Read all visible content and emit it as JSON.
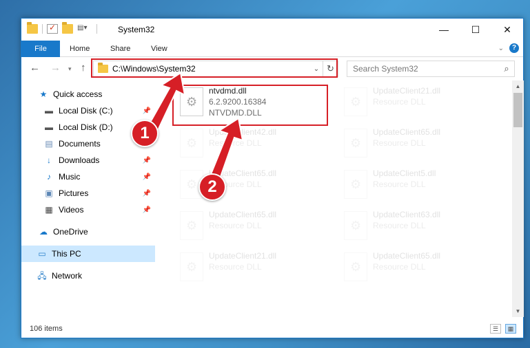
{
  "window": {
    "title": "System32",
    "controls": {
      "minimize": "—",
      "maximize": "☐",
      "close": "✕"
    }
  },
  "ribbon": {
    "tabs": [
      {
        "label": "File"
      },
      {
        "label": "Home"
      },
      {
        "label": "Share"
      },
      {
        "label": "View"
      }
    ],
    "help": "?"
  },
  "address": {
    "path": "C:\\Windows\\System32"
  },
  "search": {
    "placeholder": "Search System32"
  },
  "nav": {
    "items": [
      {
        "label": "Quick access",
        "icon": "star-icon"
      },
      {
        "label": "Local Disk (C:)",
        "icon": "drive-icon",
        "pinned": true
      },
      {
        "label": "Local Disk (D:)",
        "icon": "drive-icon"
      },
      {
        "label": "Documents",
        "icon": "documents-icon",
        "pinned": true
      },
      {
        "label": "Downloads",
        "icon": "download-icon",
        "pinned": true
      },
      {
        "label": "Music",
        "icon": "music-icon",
        "pinned": true
      },
      {
        "label": "Pictures",
        "icon": "pictures-icon",
        "pinned": true
      },
      {
        "label": "Videos",
        "icon": "videos-icon",
        "pinned": true
      },
      {
        "label": "OneDrive",
        "icon": "cloud-icon"
      },
      {
        "label": "This PC",
        "icon": "computer-icon",
        "selected": true
      },
      {
        "label": "Network",
        "icon": "network-icon"
      }
    ]
  },
  "files": [
    {
      "name": "ntvdmd.dll",
      "line2": "6.2.9200.16384",
      "line3": "NTVDMD.DLL",
      "faded": false
    },
    {
      "name": "UpdateClient21.dll",
      "line2": "Resource DLL",
      "faded": true
    },
    {
      "name": "UpdateClient42.dll",
      "line2": "Resource DLL",
      "faded": true
    },
    {
      "name": "UpdateClient65.dll",
      "line2": "Resource DLL",
      "faded": true
    },
    {
      "name": "UpdateClient65.dll",
      "line2": "Resource DLL",
      "faded": true
    },
    {
      "name": "UpdateClient5.dll",
      "line2": "Resource DLL",
      "faded": true
    },
    {
      "name": "UpdateClient65.dll",
      "line2": "Resource DLL",
      "faded": true
    },
    {
      "name": "UpdateClient63.dll",
      "line2": "Resource DLL",
      "faded": true
    },
    {
      "name": "UpdateClient21.dll",
      "line2": "Resource DLL",
      "faded": true
    },
    {
      "name": "UpdateClient65.dll",
      "line2": "Resource DLL",
      "faded": true
    }
  ],
  "status": {
    "count": "106 items"
  },
  "annotations": {
    "step1": "1",
    "step2": "2",
    "color": "#d61f26"
  }
}
